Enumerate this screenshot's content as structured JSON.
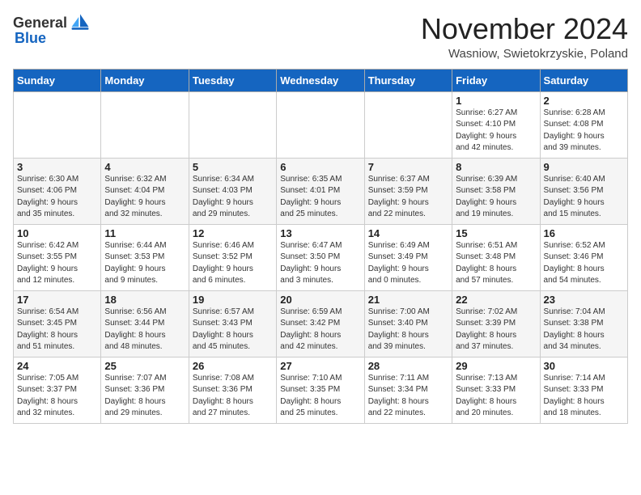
{
  "header": {
    "logo_general": "General",
    "logo_blue": "Blue",
    "month_title": "November 2024",
    "location": "Wasniow, Swietokrzyskie, Poland"
  },
  "columns": [
    "Sunday",
    "Monday",
    "Tuesday",
    "Wednesday",
    "Thursday",
    "Friday",
    "Saturday"
  ],
  "weeks": [
    {
      "days": [
        {
          "num": "",
          "info": ""
        },
        {
          "num": "",
          "info": ""
        },
        {
          "num": "",
          "info": ""
        },
        {
          "num": "",
          "info": ""
        },
        {
          "num": "",
          "info": ""
        },
        {
          "num": "1",
          "info": "Sunrise: 6:27 AM\nSunset: 4:10 PM\nDaylight: 9 hours\nand 42 minutes."
        },
        {
          "num": "2",
          "info": "Sunrise: 6:28 AM\nSunset: 4:08 PM\nDaylight: 9 hours\nand 39 minutes."
        }
      ]
    },
    {
      "days": [
        {
          "num": "3",
          "info": "Sunrise: 6:30 AM\nSunset: 4:06 PM\nDaylight: 9 hours\nand 35 minutes."
        },
        {
          "num": "4",
          "info": "Sunrise: 6:32 AM\nSunset: 4:04 PM\nDaylight: 9 hours\nand 32 minutes."
        },
        {
          "num": "5",
          "info": "Sunrise: 6:34 AM\nSunset: 4:03 PM\nDaylight: 9 hours\nand 29 minutes."
        },
        {
          "num": "6",
          "info": "Sunrise: 6:35 AM\nSunset: 4:01 PM\nDaylight: 9 hours\nand 25 minutes."
        },
        {
          "num": "7",
          "info": "Sunrise: 6:37 AM\nSunset: 3:59 PM\nDaylight: 9 hours\nand 22 minutes."
        },
        {
          "num": "8",
          "info": "Sunrise: 6:39 AM\nSunset: 3:58 PM\nDaylight: 9 hours\nand 19 minutes."
        },
        {
          "num": "9",
          "info": "Sunrise: 6:40 AM\nSunset: 3:56 PM\nDaylight: 9 hours\nand 15 minutes."
        }
      ]
    },
    {
      "days": [
        {
          "num": "10",
          "info": "Sunrise: 6:42 AM\nSunset: 3:55 PM\nDaylight: 9 hours\nand 12 minutes."
        },
        {
          "num": "11",
          "info": "Sunrise: 6:44 AM\nSunset: 3:53 PM\nDaylight: 9 hours\nand 9 minutes."
        },
        {
          "num": "12",
          "info": "Sunrise: 6:46 AM\nSunset: 3:52 PM\nDaylight: 9 hours\nand 6 minutes."
        },
        {
          "num": "13",
          "info": "Sunrise: 6:47 AM\nSunset: 3:50 PM\nDaylight: 9 hours\nand 3 minutes."
        },
        {
          "num": "14",
          "info": "Sunrise: 6:49 AM\nSunset: 3:49 PM\nDaylight: 9 hours\nand 0 minutes."
        },
        {
          "num": "15",
          "info": "Sunrise: 6:51 AM\nSunset: 3:48 PM\nDaylight: 8 hours\nand 57 minutes."
        },
        {
          "num": "16",
          "info": "Sunrise: 6:52 AM\nSunset: 3:46 PM\nDaylight: 8 hours\nand 54 minutes."
        }
      ]
    },
    {
      "days": [
        {
          "num": "17",
          "info": "Sunrise: 6:54 AM\nSunset: 3:45 PM\nDaylight: 8 hours\nand 51 minutes."
        },
        {
          "num": "18",
          "info": "Sunrise: 6:56 AM\nSunset: 3:44 PM\nDaylight: 8 hours\nand 48 minutes."
        },
        {
          "num": "19",
          "info": "Sunrise: 6:57 AM\nSunset: 3:43 PM\nDaylight: 8 hours\nand 45 minutes."
        },
        {
          "num": "20",
          "info": "Sunrise: 6:59 AM\nSunset: 3:42 PM\nDaylight: 8 hours\nand 42 minutes."
        },
        {
          "num": "21",
          "info": "Sunrise: 7:00 AM\nSunset: 3:40 PM\nDaylight: 8 hours\nand 39 minutes."
        },
        {
          "num": "22",
          "info": "Sunrise: 7:02 AM\nSunset: 3:39 PM\nDaylight: 8 hours\nand 37 minutes."
        },
        {
          "num": "23",
          "info": "Sunrise: 7:04 AM\nSunset: 3:38 PM\nDaylight: 8 hours\nand 34 minutes."
        }
      ]
    },
    {
      "days": [
        {
          "num": "24",
          "info": "Sunrise: 7:05 AM\nSunset: 3:37 PM\nDaylight: 8 hours\nand 32 minutes."
        },
        {
          "num": "25",
          "info": "Sunrise: 7:07 AM\nSunset: 3:36 PM\nDaylight: 8 hours\nand 29 minutes."
        },
        {
          "num": "26",
          "info": "Sunrise: 7:08 AM\nSunset: 3:36 PM\nDaylight: 8 hours\nand 27 minutes."
        },
        {
          "num": "27",
          "info": "Sunrise: 7:10 AM\nSunset: 3:35 PM\nDaylight: 8 hours\nand 25 minutes."
        },
        {
          "num": "28",
          "info": "Sunrise: 7:11 AM\nSunset: 3:34 PM\nDaylight: 8 hours\nand 22 minutes."
        },
        {
          "num": "29",
          "info": "Sunrise: 7:13 AM\nSunset: 3:33 PM\nDaylight: 8 hours\nand 20 minutes."
        },
        {
          "num": "30",
          "info": "Sunrise: 7:14 AM\nSunset: 3:33 PM\nDaylight: 8 hours\nand 18 minutes."
        }
      ]
    }
  ]
}
